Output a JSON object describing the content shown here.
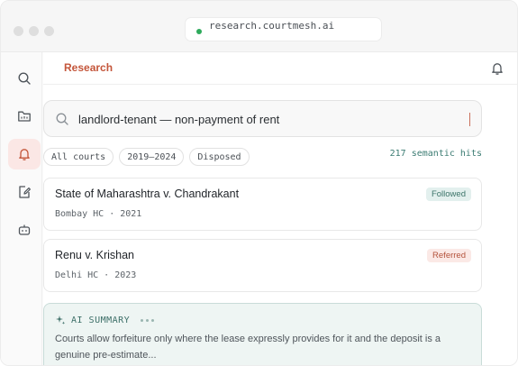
{
  "browser": {
    "url": "research.courtmesh.ai"
  },
  "sidebar": {
    "items": [
      {
        "icon": "search-icon",
        "active": false
      },
      {
        "icon": "folder-icon",
        "active": false
      },
      {
        "icon": "bell-icon",
        "active": true
      },
      {
        "icon": "edit-document-icon",
        "active": false
      },
      {
        "icon": "bot-icon",
        "active": false
      }
    ]
  },
  "header": {
    "title": "Research"
  },
  "search": {
    "query": "landlord-tenant — non-payment of rent"
  },
  "filters": {
    "chips": [
      "All courts",
      "2019–2024",
      "Disposed"
    ],
    "hits": "217 semantic hits"
  },
  "results": [
    {
      "title": "State of Maharashtra v. Chandrakant",
      "meta": "Bombay HC · 2021",
      "badge": "Followed"
    },
    {
      "title": "Renu v. Krishan",
      "meta": "Delhi HC · 2023",
      "badge": "Referred"
    }
  ],
  "summary": {
    "label": "AI SUMMARY",
    "text": "Courts allow forfeiture only where the lease expressly provides for it and the deposit is a genuine pre-estimate..."
  },
  "colors": {
    "accent": "#c4563b",
    "teal": "#3c7c73",
    "active_bg": "#fbe7e5"
  }
}
